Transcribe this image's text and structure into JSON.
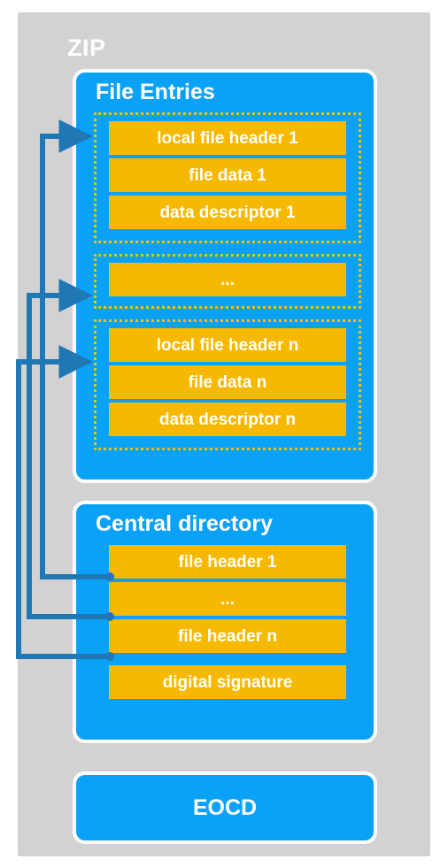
{
  "diagram": {
    "title": "ZIP",
    "palette": {
      "background": "#ffffff",
      "outer_panel": "#d2d2d2",
      "section": "#0aa2f7",
      "record": "#f6b900",
      "dashed_border": "#f2c200",
      "connector": "#1f77b4",
      "text": "#ffffff"
    }
  },
  "sections": {
    "file_entries": {
      "title": "File Entries",
      "groups": [
        {
          "id": "group-1",
          "records": [
            "local file header 1",
            "file data 1",
            "data descriptor 1"
          ]
        },
        {
          "id": "group-ellipsis",
          "records": [
            "..."
          ]
        },
        {
          "id": "group-n",
          "records": [
            "local file header n",
            "file data n",
            "data descriptor n"
          ]
        }
      ]
    },
    "central_directory": {
      "title": "Central directory",
      "records": [
        "file header 1",
        "...",
        "file header n",
        "digital signature"
      ]
    },
    "eocd": {
      "title": "EOCD"
    }
  },
  "connectors": [
    {
      "from": "file header 1",
      "to": "local file header 1"
    },
    {
      "from": "...",
      "to": "..."
    },
    {
      "from": "file header n",
      "to": "local file header n"
    }
  ]
}
